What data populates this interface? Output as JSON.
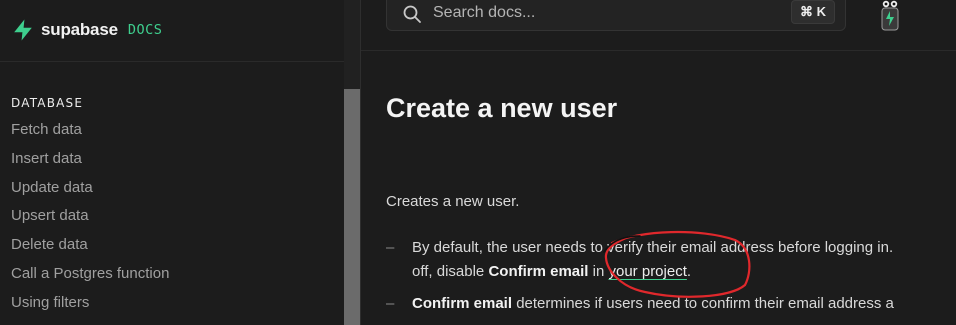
{
  "brand": {
    "name": "supabase",
    "tag": "DOCS",
    "accent": "#3ecf8e"
  },
  "sidebar": {
    "section": "DATABASE",
    "items": [
      {
        "label": "Fetch data"
      },
      {
        "label": "Insert data"
      },
      {
        "label": "Update data"
      },
      {
        "label": "Upsert data"
      },
      {
        "label": "Delete data"
      },
      {
        "label": "Call a Postgres function"
      },
      {
        "label": "Using filters"
      }
    ]
  },
  "search": {
    "placeholder": "Search docs...",
    "shortcut_symbol": "⌘",
    "shortcut_key": "K"
  },
  "page": {
    "title": "Create a new user",
    "lead": "Creates a new user.",
    "bullet1": {
      "dash": "–",
      "line1": "By default, the user needs to verify their email address before logging in.",
      "line2_prefix": "off, disable ",
      "line2_bold": "Confirm email",
      "line2_mid": " in ",
      "line2_link": "your project",
      "line2_suffix": "."
    },
    "bullet2": {
      "dash": "–",
      "bold": "Confirm email",
      "rest": " determines if users need to confirm their email address a"
    }
  },
  "annotation": {
    "color": "#e0282c",
    "shape": "hand-drawn circle around link"
  }
}
